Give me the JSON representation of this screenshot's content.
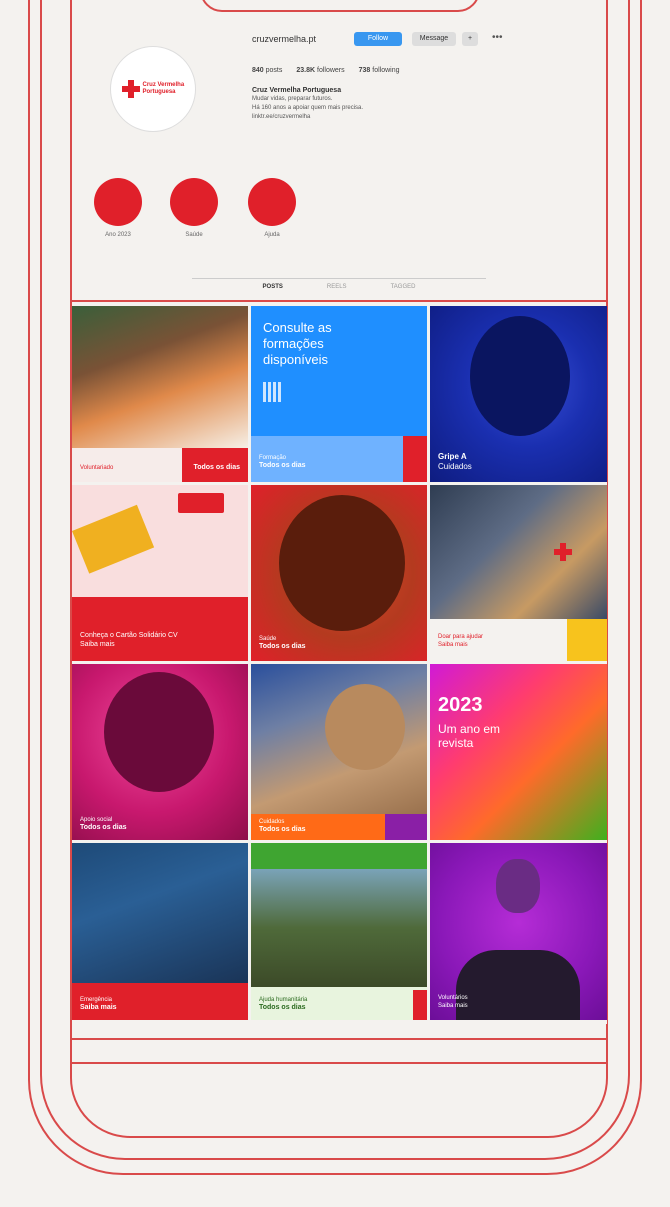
{
  "profile": {
    "username": "cruzvermelha.pt",
    "follow_label": "Follow",
    "message_label": "Message",
    "add_label": "+",
    "more_label": "•••",
    "stats": {
      "posts": "840",
      "posts_label": "posts",
      "followers": "23.8K",
      "followers_label": "followers",
      "following": "738",
      "following_label": "following"
    },
    "display_name": "Cruz Vermelha Portuguesa",
    "bio_line1": "Mudar vidas, preparar futuros.",
    "bio_line2": "Há 160 anos a apoiar quem mais precisa.",
    "bio_link": "linktr.ee/cruzvermelha",
    "avatar_text": "Cruz Vermelha Portuguesa"
  },
  "highlights": [
    {
      "label": "Ano 2023"
    },
    {
      "label": "Saúde"
    },
    {
      "label": "Ajuda"
    }
  ],
  "tabs": [
    {
      "label": "POSTS",
      "active": true
    },
    {
      "label": "REELS",
      "active": false
    },
    {
      "label": "TAGGED",
      "active": false
    }
  ],
  "tiles": {
    "t1": {
      "caption": "Voluntariado",
      "sub": "Todos os dias"
    },
    "t2": {
      "title": "Consulte as formações disponíveis",
      "caption": "Formação",
      "sub": "Todos os dias"
    },
    "t3": {
      "line1": "Gripe A",
      "line2": "Cuidados"
    },
    "t4": {
      "caption": "Conheça o Cartão Solidário CV",
      "sub": "Saiba mais"
    },
    "t5": {
      "caption": "Saúde",
      "sub": "Todos os dias"
    },
    "t6": {
      "caption": "Doar para ajudar",
      "sub": "Saiba mais"
    },
    "t7": {
      "caption": "Apoio social",
      "sub": "Todos os dias"
    },
    "t8": {
      "caption": "Cuidados",
      "sub": "Todos os dias"
    },
    "t9": {
      "year": "2023",
      "sub": "Um ano em revista"
    },
    "t10": {
      "caption": "Emergência",
      "sub": "Saiba mais"
    },
    "t11": {
      "caption": "Ajuda humanitária",
      "sub": "Todos os dias"
    },
    "t12": {
      "caption": "Voluntários",
      "sub": "Saiba mais"
    }
  },
  "colors": {
    "brand_red": "#e0202a",
    "follow_blue": "#3897f0"
  }
}
